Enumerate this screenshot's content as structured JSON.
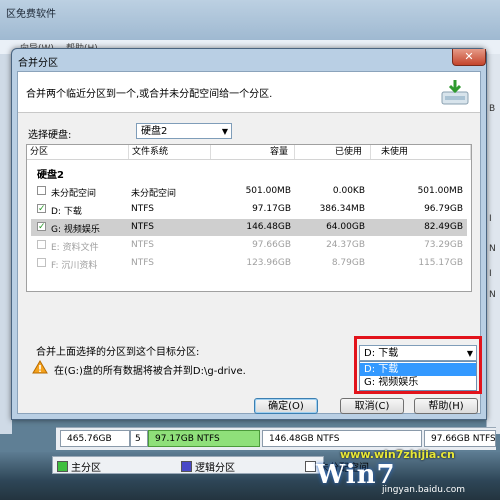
{
  "background_app": {
    "title": "区免费软件",
    "menu": [
      "向导(W)",
      "帮助(H)"
    ],
    "right_edge_ticks": [
      "B",
      "I",
      "N",
      "I",
      "N"
    ],
    "disk_map": {
      "disk_size": "465.76GB",
      "disk_num": "5",
      "cells": [
        "97.17GB NTFS",
        "146.48GB NTFS",
        "97.66GB NTFS"
      ]
    },
    "legend": [
      "主分区",
      "逻辑分区",
      "未分配空间"
    ]
  },
  "dialog": {
    "title": "合并分区",
    "close_label": "✕",
    "description": "合并两个临近分区到一个,或合并未分配空间给一个分区.",
    "select_disk_label": "选择硬盘:",
    "select_disk_value": "硬盘2",
    "table": {
      "headers": [
        "分区",
        "文件系统",
        "容量",
        "已使用",
        "未使用"
      ],
      "group": "硬盘2",
      "rows": [
        {
          "checked": false,
          "disabled": false,
          "selected": false,
          "name": "未分配空间",
          "fs": "未分配空间",
          "capacity": "501.00MB",
          "used": "0.00KB",
          "free": "501.00MB"
        },
        {
          "checked": true,
          "disabled": false,
          "selected": false,
          "name": "D: 下载",
          "fs": "NTFS",
          "capacity": "97.17GB",
          "used": "386.34MB",
          "free": "96.79GB"
        },
        {
          "checked": true,
          "disabled": false,
          "selected": true,
          "name": "G: 视频娱乐",
          "fs": "NTFS",
          "capacity": "146.48GB",
          "used": "64.00GB",
          "free": "82.49GB"
        },
        {
          "checked": false,
          "disabled": true,
          "selected": false,
          "name": "E: 资料文件",
          "fs": "NTFS",
          "capacity": "97.66GB",
          "used": "24.37GB",
          "free": "73.29GB"
        },
        {
          "checked": false,
          "disabled": true,
          "selected": false,
          "name": "F: 沉川资料",
          "fs": "NTFS",
          "capacity": "123.96GB",
          "used": "8.79GB",
          "free": "115.17GB"
        }
      ]
    },
    "target_label": "合并上面选择的分区到这个目标分区:",
    "target_value": "D: 下载",
    "target_options": [
      "D: 下载",
      "G: 视频娱乐"
    ],
    "warning": "在(G:)盘的所有数据将被合并到D:\\g-drive.",
    "buttons": {
      "ok": "确定(O)",
      "cancel": "取消(C)",
      "help": "帮助(H)"
    }
  },
  "watermark": {
    "logo": "Win7",
    "url_top": "www.win7zhijia.cn",
    "url_bottom": "jingyan.baidu.com"
  },
  "colors": {
    "primary_swatch": "#3fbf3f",
    "logical_swatch": "#4a4ac8",
    "unallocated_swatch": "#ffffff",
    "highlight": "#3399ff",
    "annotation_red": "#e2131b"
  }
}
